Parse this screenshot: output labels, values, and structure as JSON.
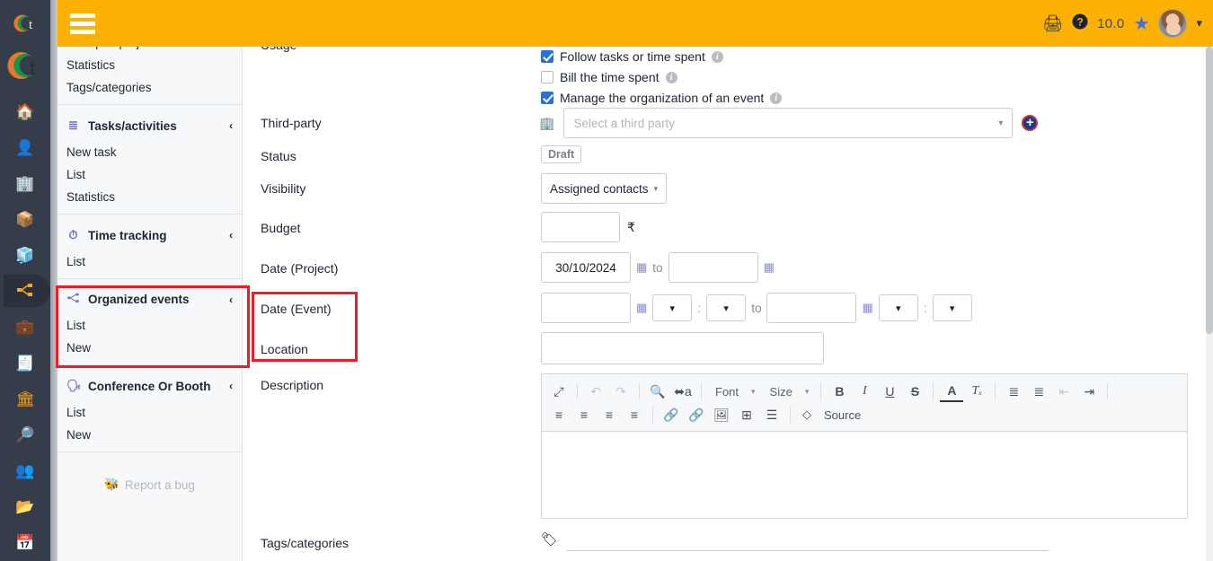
{
  "brand": {
    "logo_letter": "t",
    "name": "Dolibarr"
  },
  "topbar": {
    "menu_icon": "hamburger-icon",
    "print_icon": "printer-icon",
    "help_icon": "question-circle-icon",
    "version": "10.0",
    "star_icon": "star-icon",
    "avatar": "user-avatar",
    "caret": "▾"
  },
  "rail": {
    "items": [
      {
        "name": "home",
        "icon": "🏠",
        "active": false
      },
      {
        "name": "third-party",
        "icon": "👤",
        "active": false
      },
      {
        "name": "building",
        "icon": "🏢",
        "active": false
      },
      {
        "name": "product",
        "icon": "📦",
        "active": false
      },
      {
        "name": "stock",
        "icon": "🧊",
        "active": false
      },
      {
        "name": "projects",
        "icon": "⚭",
        "active": true
      },
      {
        "name": "commercial",
        "icon": "💼",
        "active": false
      },
      {
        "name": "billing",
        "icon": "🧾",
        "active": false
      },
      {
        "name": "bank",
        "icon": "🏛",
        "active": false
      },
      {
        "name": "accounting",
        "icon": "🔎",
        "active": false
      },
      {
        "name": "hrm",
        "icon": "👔",
        "active": false
      },
      {
        "name": "documents",
        "icon": "📂",
        "active": false
      },
      {
        "name": "agenda",
        "icon": "📅",
        "active": false
      }
    ]
  },
  "sidebar": {
    "top_cut_item": "List open projects",
    "items_top": [
      {
        "label": "Statistics"
      },
      {
        "label": "Tags/categories"
      }
    ],
    "sections": [
      {
        "title": "Tasks/activities",
        "icon": "task-list-icon",
        "chevron": "‹",
        "links": [
          {
            "label": "New task"
          },
          {
            "label": "List"
          },
          {
            "label": "Statistics"
          }
        ]
      },
      {
        "title": "Time tracking",
        "icon": "clock-icon",
        "chevron": "‹",
        "links": [
          {
            "label": "List"
          }
        ]
      },
      {
        "title": "Organized events",
        "icon": "events-icon",
        "chevron": "‹",
        "highlighted": true,
        "links": [
          {
            "label": "List"
          },
          {
            "label": "New"
          }
        ]
      },
      {
        "title": "Conference Or Booth",
        "icon": "conference-icon",
        "chevron": "‹",
        "links": [
          {
            "label": "List"
          },
          {
            "label": "New"
          }
        ]
      }
    ],
    "report_bug": {
      "label": "Report a bug",
      "icon": "bug-icon"
    }
  },
  "form": {
    "labels": {
      "usage": "Usage",
      "third_party": "Third-party",
      "status": "Status",
      "visibility": "Visibility",
      "budget": "Budget",
      "date_project": "Date (Project)",
      "date_event": "Date (Event)",
      "location": "Location",
      "description": "Description",
      "tags": "Tags/categories"
    },
    "checkboxes": [
      {
        "label": "Follow tasks or time spent",
        "checked": true,
        "info": "i"
      },
      {
        "label": "Bill the time spent",
        "checked": false,
        "info": "i"
      },
      {
        "label": "Manage the organization of an event",
        "checked": true,
        "info": "i"
      }
    ],
    "third_party": {
      "placeholder": "Select a third party",
      "value": "",
      "icon": "building-icon",
      "dropdown_caret": "▾",
      "add_button": "+"
    },
    "status_badge": "Draft",
    "visibility_value": "Assigned contacts",
    "visibility_caret": "▾",
    "budget": {
      "value": "",
      "currency": "₹"
    },
    "date_project": {
      "start": "30/10/2024",
      "end": "",
      "separator": "to",
      "calendar_icon": "calendar-icon"
    },
    "date_event": {
      "start": "",
      "end": "",
      "separator": "to",
      "start_hour": "",
      "start_min": "",
      "end_hour": "",
      "end_min": "",
      "colon": ":",
      "calendar_icon": "calendar-icon"
    },
    "location": {
      "value": ""
    },
    "tags": {
      "value": "",
      "icon": "tag-icon"
    }
  },
  "editor": {
    "row1": [
      {
        "name": "maximize",
        "glyph": "⤢",
        "dim": false
      },
      {
        "name": "undo",
        "glyph": "↶",
        "dim": true
      },
      {
        "name": "redo",
        "glyph": "↷",
        "dim": true
      },
      {
        "name": "find",
        "glyph": "🔍",
        "dim": false
      },
      {
        "name": "replace",
        "glyph": "⬌а",
        "dim": false
      }
    ],
    "font_combo": {
      "label": "Font",
      "caret": "▾"
    },
    "size_combo": {
      "label": "Size",
      "caret": "▾"
    },
    "row1b": [
      {
        "name": "bold",
        "glyph": "B",
        "dim": false
      },
      {
        "name": "italic",
        "glyph": "I",
        "dim": false
      },
      {
        "name": "underline",
        "glyph": "U",
        "dim": false
      },
      {
        "name": "strikethrough",
        "glyph": "S",
        "dim": false
      },
      {
        "name": "text-color",
        "glyph": "A",
        "dim": false
      },
      {
        "name": "remove-format",
        "glyph": "Tₓ",
        "dim": false
      },
      {
        "name": "numbered-list",
        "glyph": "≣",
        "dim": false
      },
      {
        "name": "bulleted-list",
        "glyph": "≣",
        "dim": false
      },
      {
        "name": "outdent",
        "glyph": "⇤",
        "dim": true
      },
      {
        "name": "indent",
        "glyph": "⇥",
        "dim": false
      }
    ],
    "row2": [
      {
        "name": "align-left",
        "glyph": "≡",
        "dim": false
      },
      {
        "name": "align-center",
        "glyph": "≡",
        "dim": false
      },
      {
        "name": "align-right",
        "glyph": "≡",
        "dim": false
      },
      {
        "name": "justify",
        "glyph": "≡",
        "dim": false
      },
      {
        "name": "link",
        "glyph": "🔗",
        "dim": false
      },
      {
        "name": "unlink",
        "glyph": "🔗",
        "dim": true
      },
      {
        "name": "image",
        "glyph": "🖼",
        "dim": false
      },
      {
        "name": "table",
        "glyph": "⊞",
        "dim": false
      },
      {
        "name": "horizontal-rule",
        "glyph": "☰",
        "dim": false
      }
    ],
    "source_button": {
      "label": "Source",
      "glyph": "◇"
    },
    "content": ""
  },
  "colors": {
    "topbar": "#fcb105",
    "rail": "#363d4a",
    "rail_icon": "#f5a623",
    "highlight": "#ee1c25",
    "checkbox": "#2574d4",
    "menu_bg": "#f7f8f9"
  }
}
